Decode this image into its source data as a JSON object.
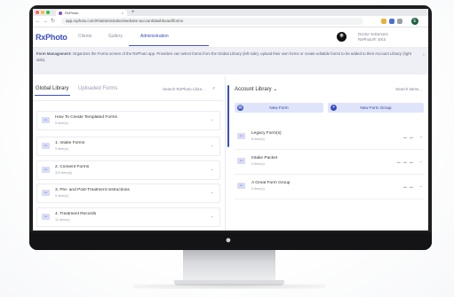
{
  "browser": {
    "tab_title": "RxPhoto",
    "tab_close": "×",
    "new_tab": "+",
    "url": "app.rxphoto.com/#/administration/website-account/dashboard/forms",
    "nav_back": "←",
    "nav_forward": "→",
    "nav_reload": "↻",
    "user_initial": "E"
  },
  "header": {
    "logo": "RxPhoto",
    "nav": [
      {
        "label": "Clients",
        "active": false
      },
      {
        "label": "Gallery",
        "active": false
      },
      {
        "label": "Administration",
        "active": true
      }
    ],
    "user_line1": "Doctor Solomons",
    "user_line2": "RxPhoto®: EKS"
  },
  "info_banner": {
    "text_bold": "Form Management:",
    "text": " Organizes the Forms screen of the RxPhoto app. Providers can select forms from the Global Library (left side), upload their own forms or create editable forms to be added to their Account Library (right side).",
    "close": "×"
  },
  "left_panel": {
    "tabs": [
      "Global Library",
      "Uploaded Forms"
    ],
    "search_placeholder": "Search RxPhoto Libra...",
    "items": [
      {
        "title": "How To Create Templated Forms",
        "subtitle": "5 item(s)"
      },
      {
        "title": "1. Intake Forms",
        "subtitle": "9 item(s)"
      },
      {
        "title": "2. Consent Forms",
        "subtitle": "313 item(s)"
      },
      {
        "title": "3. Pre- and Post-Treatment Instructions",
        "subtitle": "9 item(s)"
      },
      {
        "title": "4. Treatment Records",
        "subtitle": "11 item(s)"
      }
    ]
  },
  "right_panel": {
    "title": "Account Library",
    "title_chevron": "⌄",
    "search_placeholder": "Search items...",
    "new_form": "New Form",
    "new_form_group": "New Form Group",
    "items": [
      {
        "title": "Legacy Form(s)",
        "subtitle": "8 item(s)"
      },
      {
        "title": "Intake Packet",
        "subtitle": "0 item(s)"
      },
      {
        "title": "A Great Form Group",
        "subtitle": "0 item(s)"
      }
    ]
  },
  "colors": {
    "accent": "#3c4fbd",
    "bezel": "#1e1e20",
    "banner": "#eef0f6"
  }
}
